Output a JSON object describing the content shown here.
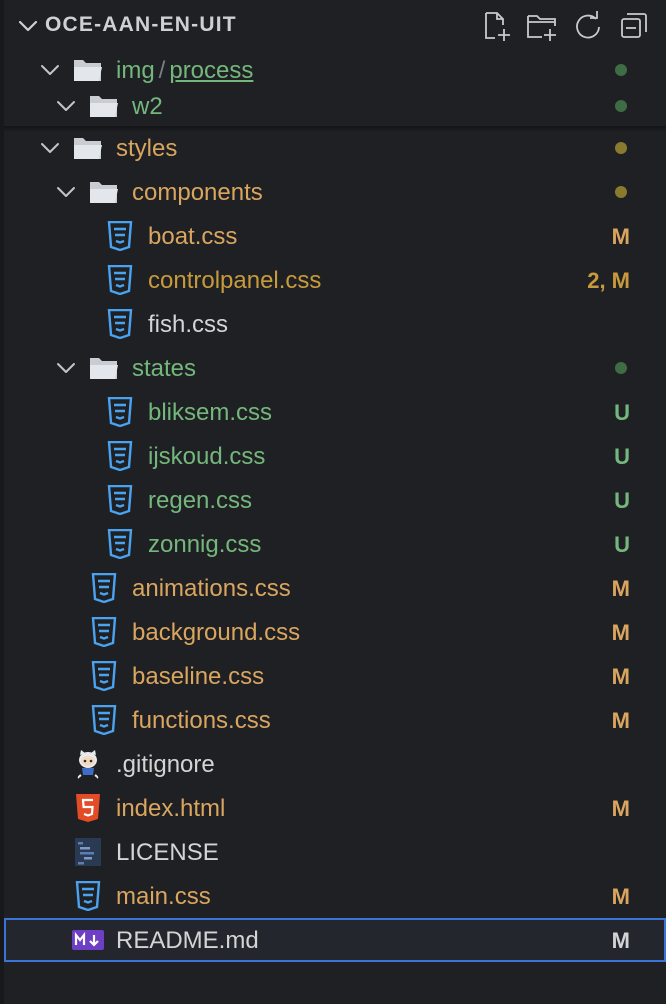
{
  "header": {
    "title": "OCE-AAN-EN-UIT",
    "actions": [
      "new-file-icon",
      "new-folder-icon",
      "refresh-icon",
      "collapse-all-icon"
    ]
  },
  "colors": {
    "green": "#74b77c",
    "orange": "#d9a55f",
    "olive_dot": "#8a7a2f",
    "green_dot": "#3f6b45",
    "css_icon": "#4aa3f0",
    "html_icon": "#e34c26",
    "md_icon": "#6e3fc4",
    "selection_border": "#3b74d6"
  },
  "tree": {
    "img_process": {
      "part1": "img",
      "separator": "/",
      "part2": "process"
    },
    "w2": {
      "label": "w2"
    },
    "styles": {
      "label": "styles"
    },
    "components": {
      "label": "components"
    },
    "boat": {
      "label": "boat.css",
      "badge": "M"
    },
    "controlpanel": {
      "label": "controlpanel.css",
      "badge": "2, M"
    },
    "fish": {
      "label": "fish.css"
    },
    "states": {
      "label": "states"
    },
    "bliksem": {
      "label": "bliksem.css",
      "badge": "U"
    },
    "ijskoud": {
      "label": "ijskoud.css",
      "badge": "U"
    },
    "regen": {
      "label": "regen.css",
      "badge": "U"
    },
    "zonnig": {
      "label": "zonnig.css",
      "badge": "U"
    },
    "animations": {
      "label": "animations.css",
      "badge": "M"
    },
    "background": {
      "label": "background.css",
      "badge": "M"
    },
    "baseline": {
      "label": "baseline.css",
      "badge": "M"
    },
    "functions": {
      "label": "functions.css",
      "badge": "M"
    },
    "gitignore": {
      "label": ".gitignore"
    },
    "index": {
      "label": "index.html",
      "badge": "M"
    },
    "license": {
      "label": "LICENSE"
    },
    "main": {
      "label": "main.css",
      "badge": "M"
    },
    "readme": {
      "label": "README.md",
      "badge": "M"
    }
  }
}
